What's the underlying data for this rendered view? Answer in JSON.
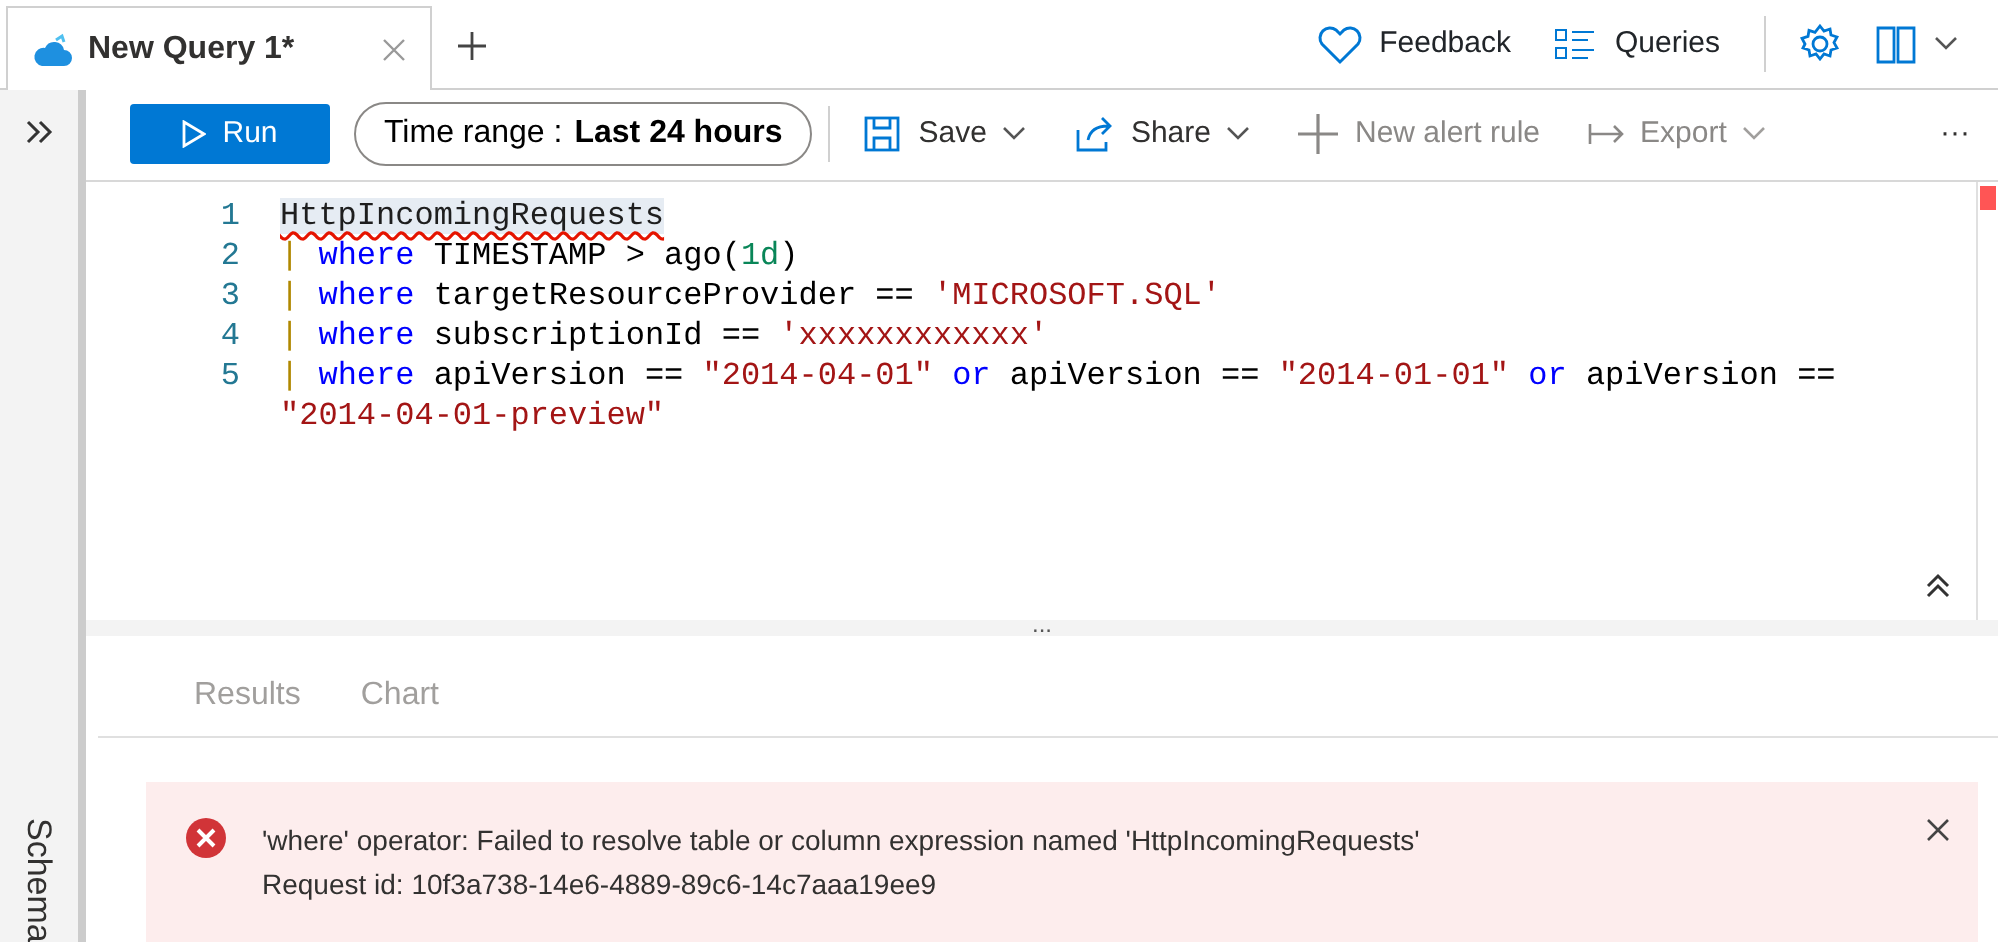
{
  "tabs": [
    {
      "label": "New Query 1*",
      "selected": true
    }
  ],
  "header_actions": [
    {
      "kind": "feedback",
      "label": "Feedback"
    },
    {
      "kind": "queries",
      "label": "Queries"
    }
  ],
  "toolbar": {
    "run": "Run",
    "time_range": {
      "label": "Time range :",
      "value": "Last 24 hours"
    },
    "actions": [
      {
        "kind": "save",
        "label": "Save",
        "disabled": false
      },
      {
        "kind": "share",
        "label": "Share",
        "disabled": false
      },
      {
        "kind": "alert",
        "label": "New alert rule",
        "disabled": true
      },
      {
        "kind": "export",
        "label": "Export",
        "disabled": true
      }
    ],
    "more": "···"
  },
  "editor": {
    "lines": [
      {
        "number": "1",
        "tokens": [
          {
            "kind": "table",
            "text": "HttpIncomingRequests"
          }
        ]
      },
      {
        "number": "2",
        "tokens": [
          {
            "kind": "pipe",
            "text": "|"
          },
          {
            "kind": "keyword",
            "text": " where"
          },
          {
            "kind": "plain",
            "text": " TIMESTAMP > ago("
          },
          {
            "kind": "number",
            "text": "1d"
          },
          {
            "kind": "plain",
            "text": ")"
          }
        ]
      },
      {
        "number": "3",
        "tokens": [
          {
            "kind": "pipe",
            "text": "|"
          },
          {
            "kind": "keyword",
            "text": " where"
          },
          {
            "kind": "plain",
            "text": " targetResourceProvider == "
          },
          {
            "kind": "string",
            "text": "'MICROSOFT.SQL'"
          }
        ]
      },
      {
        "number": "4",
        "tokens": [
          {
            "kind": "pipe",
            "text": "|"
          },
          {
            "kind": "keyword",
            "text": " where"
          },
          {
            "kind": "plain",
            "text": " subscriptionId == "
          },
          {
            "kind": "string",
            "text": "'xxxxxxxxxxxx'"
          }
        ]
      },
      {
        "number": "5",
        "tokens": [
          {
            "kind": "pipe",
            "text": "|"
          },
          {
            "kind": "keyword",
            "text": " where"
          },
          {
            "kind": "plain",
            "text": " apiVersion == "
          },
          {
            "kind": "string",
            "text": "\"2014-04-01\""
          },
          {
            "kind": "keyword",
            "text": " or"
          },
          {
            "kind": "plain",
            "text": " apiVersion == "
          },
          {
            "kind": "string",
            "text": "\"2014-01-01\""
          },
          {
            "kind": "keyword",
            "text": " or"
          },
          {
            "kind": "plain",
            "text": " apiVersion =="
          }
        ]
      },
      {
        "tokens": [
          {
            "kind": "string",
            "text": "\"2014-04-01-preview\""
          }
        ]
      }
    ]
  },
  "splitter": "...",
  "result_tabs": [
    {
      "label": "Results",
      "selected": false
    },
    {
      "label": "Chart",
      "selected": false
    }
  ],
  "error": {
    "message": "'where' operator: Failed to resolve table or column expression named 'HttpIncomingRequests'",
    "request_id": "Request id: 10f3a738-14e6-4889-89c6-14c7aaa19ee9"
  },
  "sidebar": {
    "label": "Schema"
  }
}
